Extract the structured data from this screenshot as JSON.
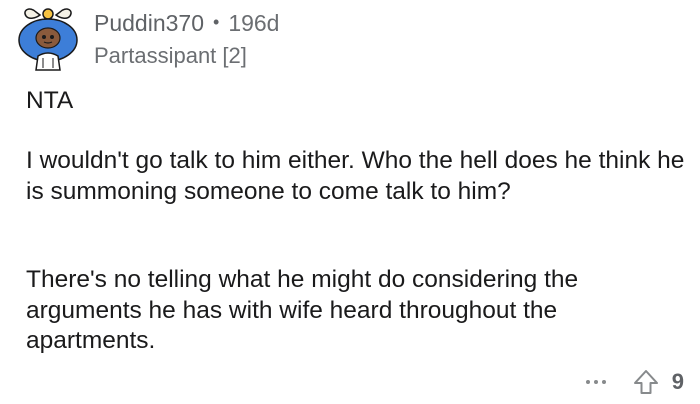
{
  "comment": {
    "author": "Puddin370",
    "separator": "•",
    "age": "196d",
    "flair": "Partassipant [2]",
    "avatar_icon": "snoo-avatar-icon",
    "paragraphs": [
      "NTA",
      "I wouldn't go talk to him either. Who the hell does he think he is summoning someone to come talk to him?",
      "There's no telling what he might do considering the arguments he has with wife heard throughout the apartments."
    ],
    "actions": {
      "more_icon": "more-options-icon",
      "upvote_icon": "upvote-arrow-icon",
      "score": "9"
    }
  },
  "colors": {
    "text": "#1a1a1b",
    "meta": "#5f6266",
    "icon": "#878a8c",
    "avatar_primary": "#3d7ed8"
  }
}
